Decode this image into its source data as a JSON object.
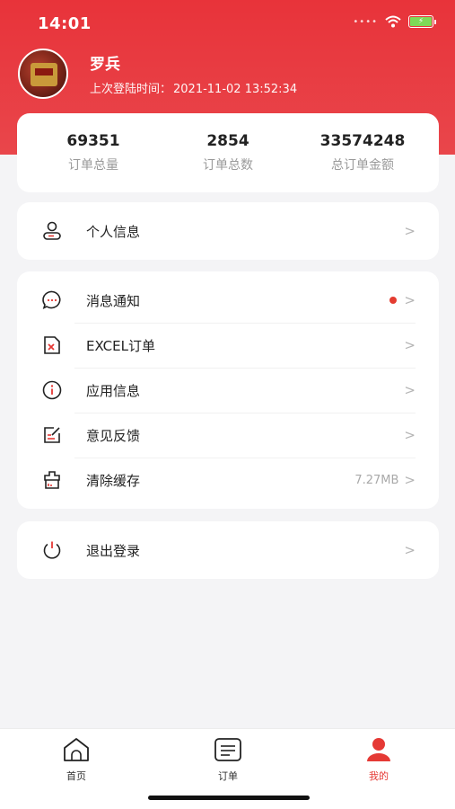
{
  "status": {
    "time": "14:01",
    "signal": "••••"
  },
  "profile": {
    "name": "罗兵",
    "login_label": "上次登陆时间：",
    "login_time": "2021-11-02 13:52:34"
  },
  "stats": [
    {
      "value": "69351",
      "label": "订单总量"
    },
    {
      "value": "2854",
      "label": "订单总数"
    },
    {
      "value": "33574248",
      "label": "总订单金额"
    }
  ],
  "menu": {
    "personal": {
      "label": "个人信息",
      "chevron": ">"
    },
    "messages": {
      "label": "消息通知",
      "chevron": ">",
      "unread": true,
      "dot_color": "#e43c30"
    },
    "excel": {
      "label": "EXCEL订单",
      "chevron": ">"
    },
    "app_info": {
      "label": "应用信息",
      "chevron": ">"
    },
    "feedback": {
      "label": "意见反馈",
      "chevron": ">"
    },
    "cache": {
      "label": "清除缓存",
      "value": "7.27MB",
      "chevron": ">"
    },
    "logout": {
      "label": "退出登录",
      "chevron": ">"
    }
  },
  "tabs": [
    {
      "label": "首页",
      "icon": "home-icon",
      "active": false
    },
    {
      "label": "订单",
      "icon": "order-icon",
      "active": false
    },
    {
      "label": "我的",
      "icon": "profile-icon",
      "active": true
    }
  ],
  "colors": {
    "accent": "#e53935",
    "header": "#e8333a"
  }
}
